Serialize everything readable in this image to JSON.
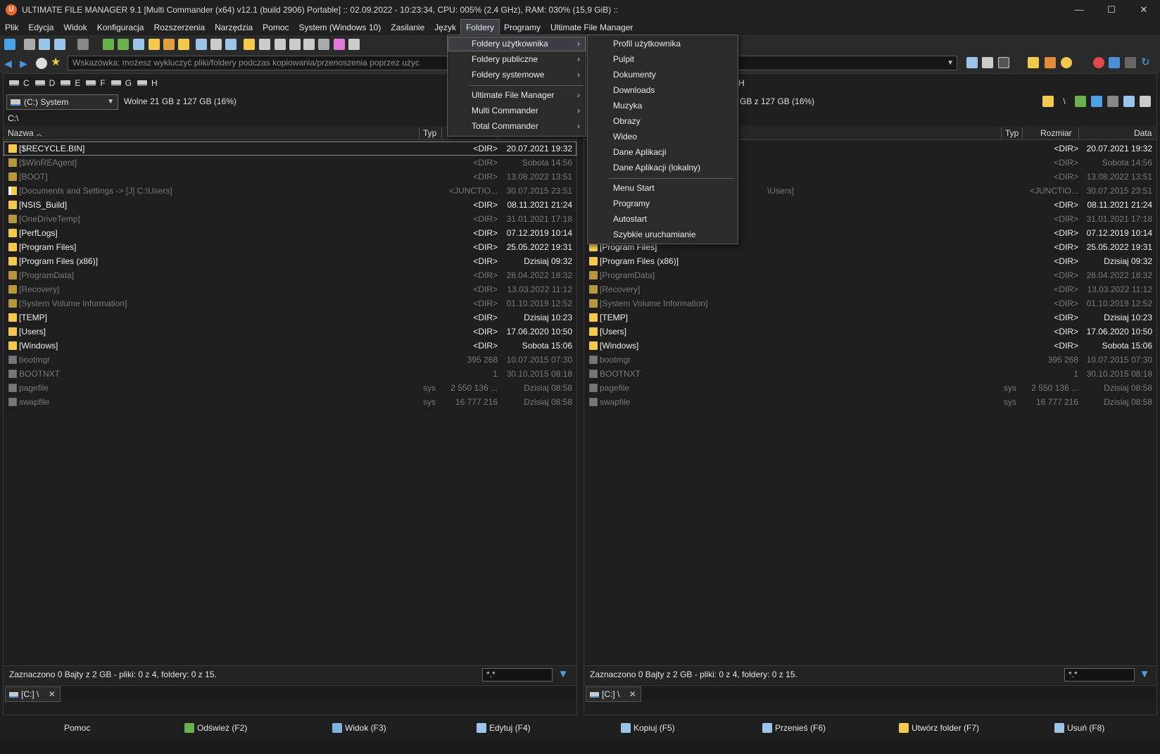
{
  "window": {
    "title": "ULTIMATE FILE MANAGER 9.1 [Multi Commander (x64)  v12.1 (build 2906) Portable] :: 02.09.2022 - 10:23:34, CPU: 005% (2,4 GHz), RAM: 030% (15,9 GiB) ::",
    "minimize": "—",
    "maximize": "☐",
    "close": "✕"
  },
  "menu": [
    "Plik",
    "Edycja",
    "Widok",
    "Konfiguracja",
    "Rozszerzenia",
    "Narzędzia",
    "Pomoc",
    "System (Windows 10)",
    "Zasilanie",
    "Język",
    "Foldery",
    "Programy",
    "Ultimate File Manager"
  ],
  "hint": "Wskazówka: możesz wykluczyć pliki/foldery podczas kopiowania/przenoszenia poprzez użyc",
  "drives": [
    "C",
    "D",
    "E",
    "F",
    "G",
    "H"
  ],
  "left": {
    "drive_select": "(C:) System",
    "free": "Wolne 21 GB z 127 GB (16%)",
    "path": "C:\\",
    "columns": {
      "name": "Nazwa",
      "typ": "Typ",
      "size": "Rozmiar",
      "date": "Data"
    },
    "status": "Zaznaczono 0 Bajty z 2 GB - pliki: 0 z 4, foldery: 0 z 15.",
    "filter": "*.*",
    "tab": "[C:] \\"
  },
  "right": {
    "free_partial": "GB z 127 GB (16%)",
    "drive_partial": "H",
    "path_partial": "\\Users]",
    "columns": {
      "typ": "Typ",
      "size": "Rozmiar",
      "date": "Data"
    },
    "status": "Zaznaczono 0 Bajty z 2 GB - pliki: 0 z 4, foldery: 0 z 15.",
    "filter": "*.*",
    "tab": "[C:] \\"
  },
  "files": [
    {
      "name": "[$RECYCLE.BIN]",
      "typ": "",
      "size": "<DIR>",
      "date": "20.07.2021 19:32",
      "dim": false,
      "icon": "folder"
    },
    {
      "name": "[$WinREAgent]",
      "typ": "",
      "size": "<DIR>",
      "date": "Sobota 14:56",
      "dim": true,
      "icon": "folder"
    },
    {
      "name": "[BOOT]",
      "typ": "",
      "size": "<DIR>",
      "date": "13.08.2022 13:51",
      "dim": true,
      "icon": "folder"
    },
    {
      "name": "[Documents and Settings ->  [J] C:\\Users]",
      "typ": "",
      "size": "<JUNCTIO...",
      "date": "30.07.2015 23:51",
      "dim": true,
      "icon": "junction"
    },
    {
      "name": "[NSIS_Build]",
      "typ": "",
      "size": "<DIR>",
      "date": "08.11.2021 21:24",
      "dim": false,
      "icon": "folder"
    },
    {
      "name": "[OneDriveTemp]",
      "typ": "",
      "size": "<DIR>",
      "date": "31.01.2021 17:18",
      "dim": true,
      "icon": "folder"
    },
    {
      "name": "[PerfLogs]",
      "typ": "",
      "size": "<DIR>",
      "date": "07.12.2019 10:14",
      "dim": false,
      "icon": "folder"
    },
    {
      "name": "[Program Files]",
      "typ": "",
      "size": "<DIR>",
      "date": "25.05.2022 19:31",
      "dim": false,
      "icon": "folder"
    },
    {
      "name": "[Program Files (x86)]",
      "typ": "",
      "size": "<DIR>",
      "date": "Dzisiaj 09:32",
      "dim": false,
      "icon": "folder"
    },
    {
      "name": "[ProgramData]",
      "typ": "",
      "size": "<DIR>",
      "date": "28.04.2022 18:32",
      "dim": true,
      "icon": "folder"
    },
    {
      "name": "[Recovery]",
      "typ": "",
      "size": "<DIR>",
      "date": "13.03.2022 11:12",
      "dim": true,
      "icon": "folder"
    },
    {
      "name": "[System Volume Information]",
      "typ": "",
      "size": "<DIR>",
      "date": "01.10.2019 12:52",
      "dim": true,
      "icon": "folder"
    },
    {
      "name": "[TEMP]",
      "typ": "",
      "size": "<DIR>",
      "date": "Dzisiaj 10:23",
      "dim": false,
      "icon": "folder"
    },
    {
      "name": "[Users]",
      "typ": "",
      "size": "<DIR>",
      "date": "17.06.2020 10:50",
      "dim": false,
      "icon": "folder"
    },
    {
      "name": "[Windows]",
      "typ": "",
      "size": "<DIR>",
      "date": "Sobota 15:06",
      "dim": false,
      "icon": "folder"
    },
    {
      "name": "bootmgr",
      "typ": "",
      "size": "395 268",
      "date": "10.07.2015 07:30",
      "dim": true,
      "icon": "file"
    },
    {
      "name": "BOOTNXT",
      "typ": "",
      "size": "1",
      "date": "30.10.2015 08:18",
      "dim": true,
      "icon": "file"
    },
    {
      "name": "pagefile",
      "typ": "sys",
      "size": "2 550 136 ...",
      "date": "Dzisiaj 08:58",
      "dim": true,
      "icon": "file"
    },
    {
      "name": "swapfile",
      "typ": "sys",
      "size": "16 777 216",
      "date": "Dzisiaj 08:58",
      "dim": true,
      "icon": "file"
    }
  ],
  "folders_menu": {
    "items": [
      {
        "label": "Foldery użytkownika",
        "submenu": true,
        "highlighted": true
      },
      {
        "label": "Foldery publiczne",
        "submenu": true
      },
      {
        "label": "Foldery systemowe",
        "submenu": true
      },
      {
        "sep": true
      },
      {
        "label": "Ultimate File Manager",
        "submenu": true
      },
      {
        "label": "Multi Commander",
        "submenu": true
      },
      {
        "label": "Total Commander",
        "submenu": true
      }
    ]
  },
  "user_folders_submenu": {
    "items": [
      {
        "label": "Profil użytkownika"
      },
      {
        "label": "Pulpit"
      },
      {
        "label": "Dokumenty"
      },
      {
        "label": "Downloads"
      },
      {
        "label": "Muzyka"
      },
      {
        "label": "Obrazy"
      },
      {
        "label": "Wideo"
      },
      {
        "label": "Dane Aplikacji"
      },
      {
        "label": "Dane Aplikacji (lokalny)"
      },
      {
        "sep": true
      },
      {
        "label": "Menu Start"
      },
      {
        "label": "Programy"
      },
      {
        "label": "Autostart"
      },
      {
        "label": "Szybkie uruchamianie"
      }
    ]
  },
  "fkeys": [
    {
      "label": "Pomoc",
      "color": ""
    },
    {
      "label": "Odśwież (F2)",
      "color": "#6ab04c"
    },
    {
      "label": "Widok (F3)",
      "color": "#7fb3e0"
    },
    {
      "label": "Edytuj (F4)",
      "color": "#9bc5e8"
    },
    {
      "label": "Kopiuj (F5)",
      "color": "#9bc5e8"
    },
    {
      "label": "Przenieś (F6)",
      "color": "#9bc5e8"
    },
    {
      "label": "Utwórz folder (F7)",
      "color": "#f2c94c"
    },
    {
      "label": "Usuń (F8)",
      "color": "#9bc5e8"
    }
  ],
  "colors": {
    "accent": "#4aa3e8",
    "folder": "#f2c94c",
    "app_icon": "#e8672a"
  }
}
